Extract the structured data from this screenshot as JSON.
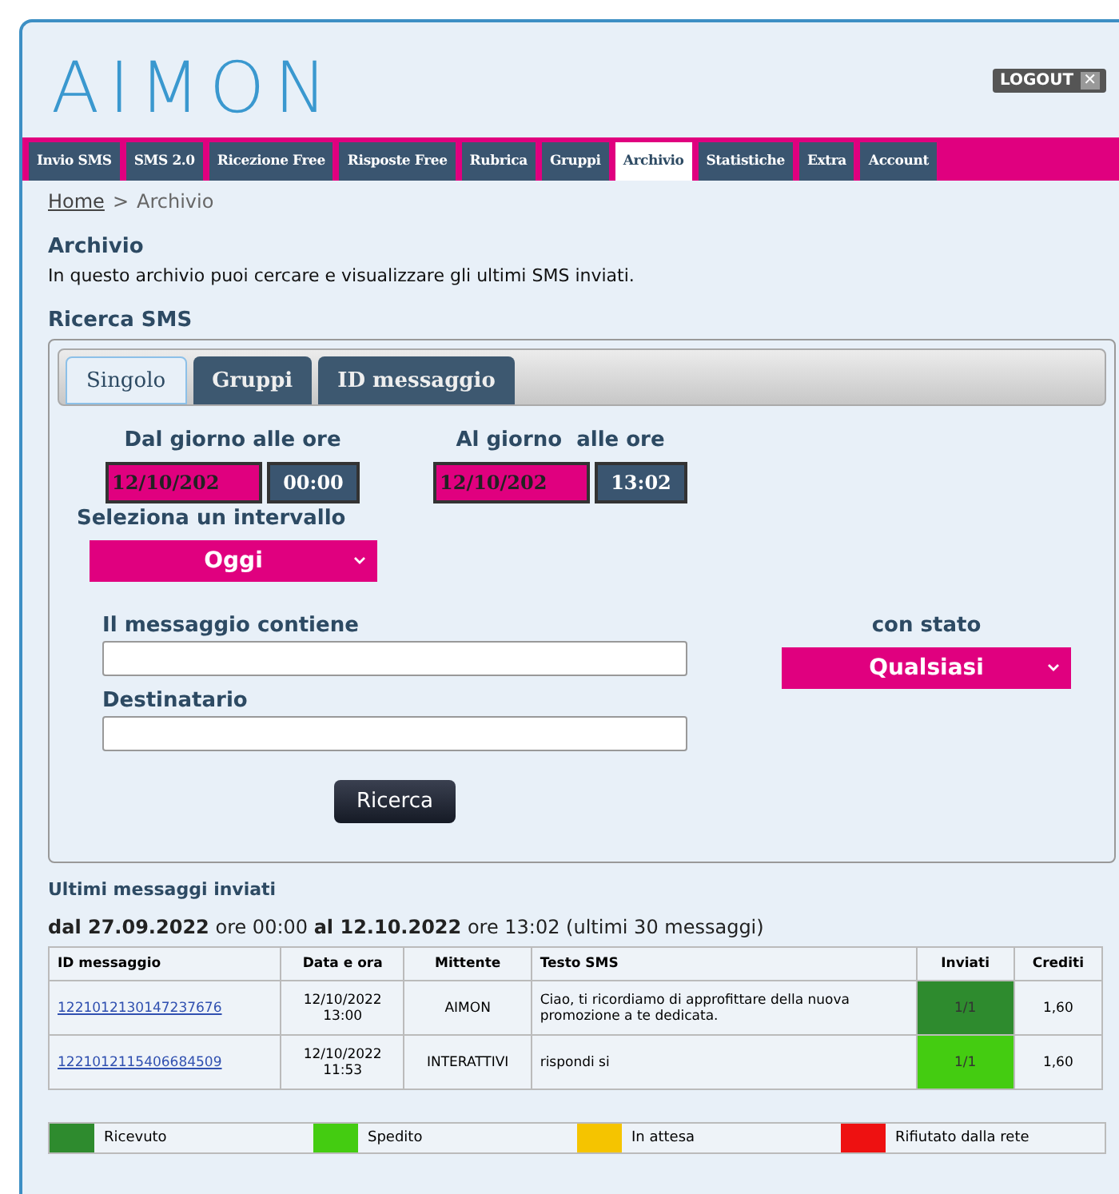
{
  "header": {
    "logo": "AIMON",
    "logout": "LOGOUT",
    "logout_close": "✕"
  },
  "nav": [
    {
      "label": "Invio SMS",
      "selected": false
    },
    {
      "label": "SMS 2.0",
      "selected": false
    },
    {
      "label": "Ricezione Free",
      "selected": false
    },
    {
      "label": "Risposte Free",
      "selected": false
    },
    {
      "label": "Rubrica",
      "selected": false
    },
    {
      "label": "Gruppi",
      "selected": false
    },
    {
      "label": "Archivio",
      "selected": true
    },
    {
      "label": "Statistiche",
      "selected": false
    },
    {
      "label": "Extra",
      "selected": false
    },
    {
      "label": "Account",
      "selected": false
    }
  ],
  "breadcrumb": {
    "home": "Home",
    "separator": ">",
    "current": "Archivio"
  },
  "page_title": "Archivio",
  "intro": "In questo archivio puoi cercare e visualizzare gli ultimi SMS inviati.",
  "search_title": "Ricerca SMS",
  "search_tabs": [
    {
      "label": "Singolo",
      "selected": true
    },
    {
      "label": "Gruppi",
      "selected": false
    },
    {
      "label": "ID messaggio",
      "selected": false
    }
  ],
  "form": {
    "from_label": "Dal giorno alle ore",
    "from_date": "12/10/202",
    "from_time": "00:00",
    "to_label": "Al giorno  alle ore",
    "to_date": "12/10/202",
    "to_time": "13:02",
    "interval_label": "Seleziona un intervallo",
    "interval_value": "Oggi",
    "message_label": "Il messaggio contiene",
    "recipient_label": "Destinatario",
    "status_label": "con stato",
    "status_value": "Qualsiasi",
    "search_button": "Ricerca"
  },
  "results": {
    "title": "Ultimi messaggi inviati",
    "range": "**dal 27.09.2022** ore 00:00 **al 12.10.2022** ore 13:02 (ultimi 30 messaggi)",
    "columns": [
      "ID messaggio",
      "Data e ora",
      "Mittente",
      "Testo SMS",
      "Inviati",
      "Crediti"
    ],
    "rows": [
      {
        "id": "1221012130147237676",
        "date": "12/10/2022",
        "time": "13:00",
        "sender": "AIMON",
        "text": "Ciao, ti ricordiamo di approfittare della nuova promozione a te dedicata.",
        "sent": "1/1",
        "color": "#2e8b2e",
        "credits": "1,60"
      },
      {
        "id": "1221012115406684509",
        "date": "12/10/2022",
        "time": "11:53",
        "sender": "INTERATTIVI",
        "text": "rispondi si",
        "sent": "1/1",
        "color": "#44cc11",
        "credits": "1,60"
      }
    ]
  },
  "legend": [
    {
      "label": "Ricevuto",
      "color": "#2e8b2e"
    },
    {
      "label": "Spedito",
      "color": "#44cc11"
    },
    {
      "label": "In attesa",
      "color": "#f5c400"
    },
    {
      "label": "Rifiutato dalla rete",
      "color": "#ee1111"
    }
  ]
}
